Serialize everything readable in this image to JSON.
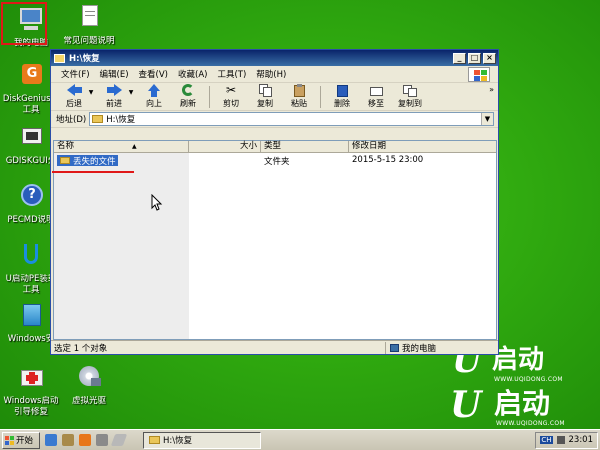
{
  "desktop": {
    "icons": [
      {
        "label": "我的电脑"
      },
      {
        "label": "常见问题说明"
      },
      {
        "label": "DiskGenius分",
        "label2": "工具"
      },
      {
        "label": "GDISKGUI分"
      },
      {
        "label": "PECMD说明"
      },
      {
        "label": "U启动PE装载",
        "label2": "工具"
      },
      {
        "label": "Windows安"
      },
      {
        "label": "Windows启动",
        "label2": "引导修复"
      },
      {
        "label": "虚拟光驱"
      }
    ]
  },
  "window": {
    "title": "H:\\恢复",
    "menu": [
      "文件(F)",
      "编辑(E)",
      "查看(V)",
      "收藏(A)",
      "工具(T)",
      "帮助(H)"
    ],
    "toolbar": {
      "back": "后退",
      "forward": "前进",
      "up": "向上",
      "refresh": "刷新",
      "cut": "剪切",
      "copy": "复制",
      "paste": "粘贴",
      "delete": "删除",
      "move_to": "移至",
      "copy_to": "复制到"
    },
    "address": {
      "label": "地址(D)",
      "value": "H:\\恢复"
    },
    "columns": {
      "name": "名称",
      "size": "大小",
      "type": "类型",
      "modified": "修改日期"
    },
    "files": [
      {
        "name": "丢失的文件",
        "type": "文件夹",
        "modified": "2015-5-15 23:00"
      }
    ],
    "status": {
      "left": "选定 1 个对象",
      "right": "我的电脑"
    }
  },
  "brand": {
    "text1": "启动",
    "url1": "WWW.UQIDONG.COM",
    "text2": "启动",
    "url2": "WWW.UQIDONG.COM"
  },
  "taskbar": {
    "start": "开始",
    "task": "H:\\恢复",
    "ime": "CH",
    "clock": "23:01"
  },
  "colors": {
    "accent": "#e01818",
    "selection": "#316ac5",
    "desktop": "#2fa80f"
  }
}
